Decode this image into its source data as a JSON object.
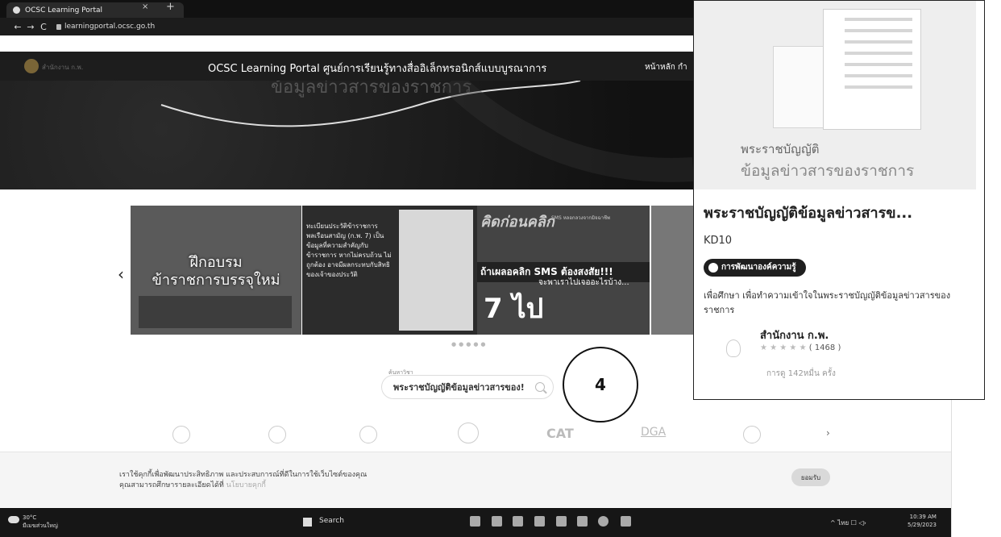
{
  "browser": {
    "tab_title": "OCSC Learning Portal",
    "tab_close": "×",
    "tab_new": "+",
    "back": "←",
    "forward": "→",
    "reload": "C",
    "url": "learningportal.ocsc.go.th"
  },
  "header": {
    "logo_text": "สำนักงาน ก.พ.",
    "title": "OCSC Learning Portal ศูนย์การเรียนรู้ทางสื่ออิเล็กทรอนิกส์แบบบูรณาการ",
    "nav_home": "หน้าหลัก  กำ"
  },
  "hero": {
    "text": "ข้อมูลข่าวสารของราชการ"
  },
  "carousel": {
    "prev": "‹",
    "slide1": {
      "line1": "ฝึกอบรม",
      "line2": "ข้าราชการบรรจุใหม่"
    },
    "slide2": {
      "text": "ทะเบียนประวัติข้าราชการพลเรือนสามัญ (ก.พ. 7) เป็นข้อมูลที่ความสำคัญกับข้าราชการ หากไม่ครบถ้วน ไม่ถูกต้อง อาจมีผลกระทบกับสิทธิของเจ้าของประวัติ"
    },
    "slide3": {
      "title": "คิดก่อนคลิก",
      "small": "SMS หลอกลวงจากมิจฉาชีพ",
      "main": "ถ้าเผลอคลิก SMS ต้องสงสัย!!!",
      "sub": "จะพาเราไปเจออะไรบ้าง...",
      "seven": "7 ไป"
    },
    "dots": "●●●●●"
  },
  "search": {
    "label": "ค้นหาวิชา",
    "value": "พระราชบัญญัติข้อมูลข่าวสารของ!",
    "annotation": "4"
  },
  "partners": {
    "cat": "CAT",
    "dga": "DGA",
    "next": "›"
  },
  "cookie": {
    "line1": "เราใช้คุกกี้เพื่อพัฒนาประสิทธิภาพ และประสบการณ์ที่ดีในการใช้เว็บไซต์ของคุณ",
    "line2": "คุณสามารถศึกษารายละเอียดได้ที่",
    "link": "นโยบายคุกกี้",
    "accept": "ยอมรับ"
  },
  "taskbar": {
    "temp": "30°C",
    "weather": "มีเมฆส่วนใหญ่",
    "search": "Search",
    "time": "10:39 AM",
    "date": "5/29/2023",
    "tray": "^  ไทย  ☐ ◁›"
  },
  "course_card": {
    "image_line1": "พระราชบัญญัติ",
    "image_line2": "ข้อมูลข่าวสารของราชการ",
    "title": "พระราชบัญญัติข้อมูลข่าวสารข...",
    "code": "KD10",
    "category": "การพัฒนาองค์ความรู้",
    "description": "เพื่อศึกษา เพื่อทำความเข้าใจในพระราชบัญญัติข้อมูลข่าวสารของราชการ",
    "organization": "สำนักงาน ก.พ.",
    "stars": "★ ★ ★ ★ ★",
    "rating_count": "( 1468 )",
    "views": "การดู 142หมื่น ครั้ง"
  }
}
